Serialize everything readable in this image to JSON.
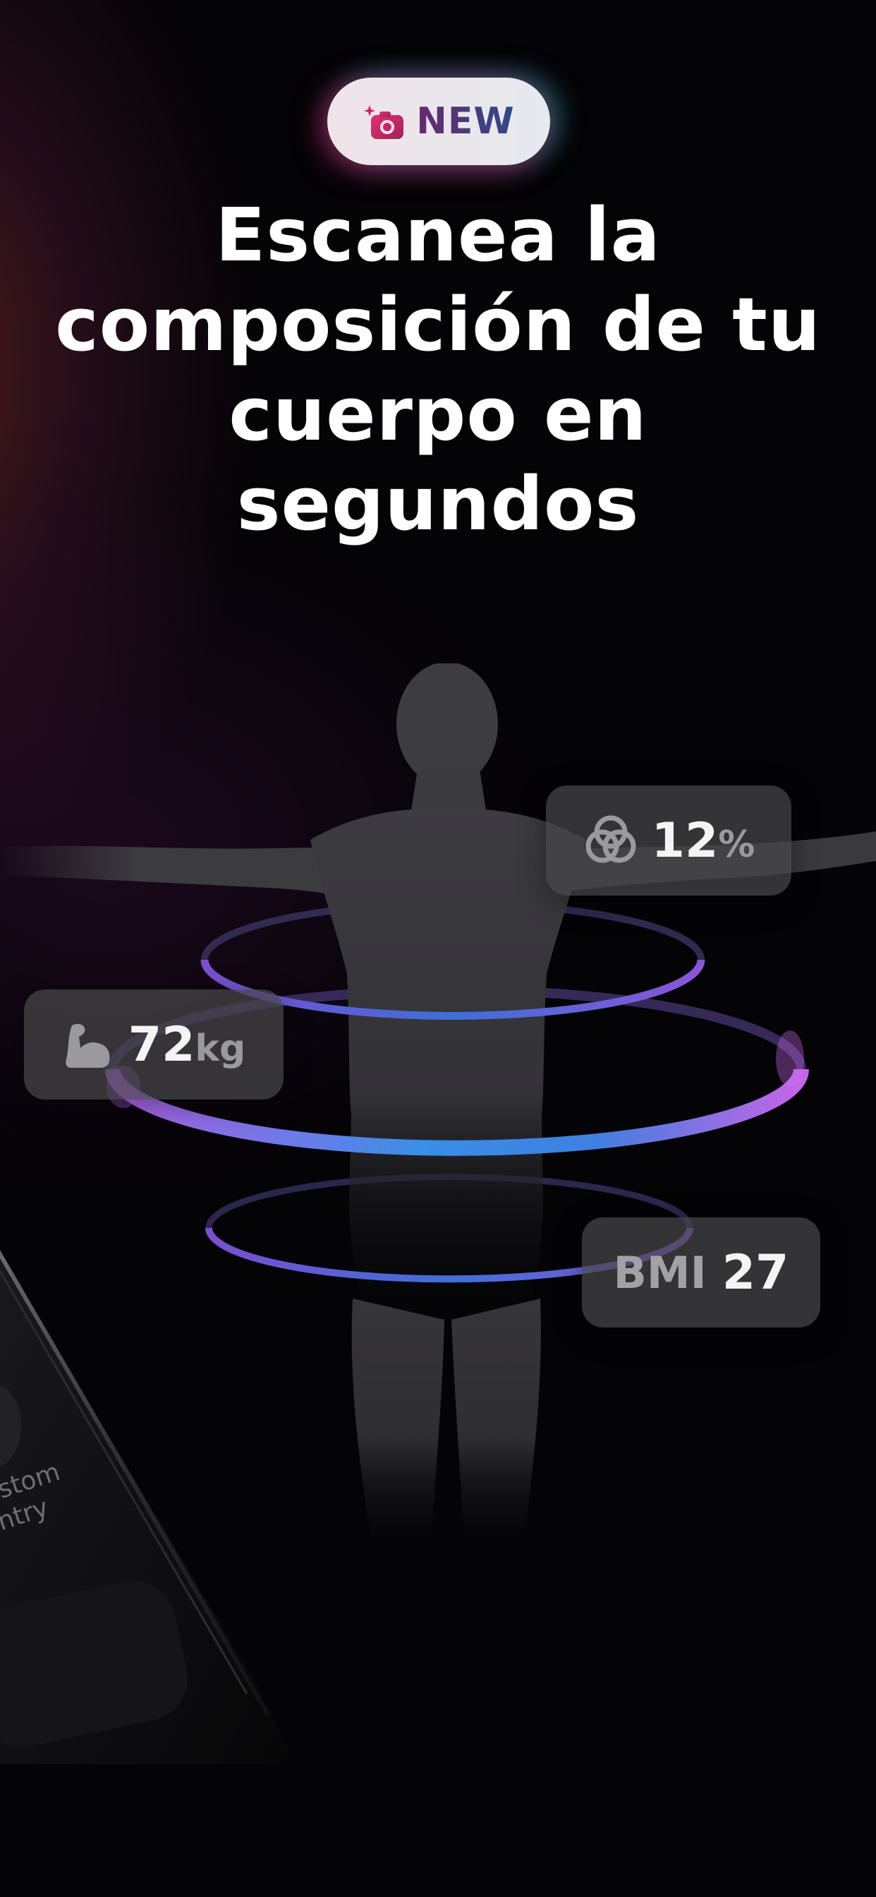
{
  "badge": {
    "icon": "camera-sparkle-icon",
    "label": "NEW"
  },
  "headline": {
    "lines": [
      "Escanea la",
      "composición de tu",
      "cuerpo en",
      "segundos"
    ]
  },
  "metrics": {
    "body_fat": {
      "icon": "overlapping-circles-icon",
      "value": "12",
      "unit": "%"
    },
    "muscle": {
      "icon": "flexed-arm-icon",
      "value": "72",
      "unit": "kg"
    },
    "bmi": {
      "label": "BMI",
      "value": "27"
    }
  },
  "phone_peek": {
    "text_lines": [
      "stom",
      "ntry"
    ]
  },
  "colors": {
    "background": "#040306",
    "ring_purple": "#b760e8",
    "ring_blue": "#3d8fe6",
    "badge_text": "#2e3d7a",
    "card_bg": "#46464a"
  }
}
